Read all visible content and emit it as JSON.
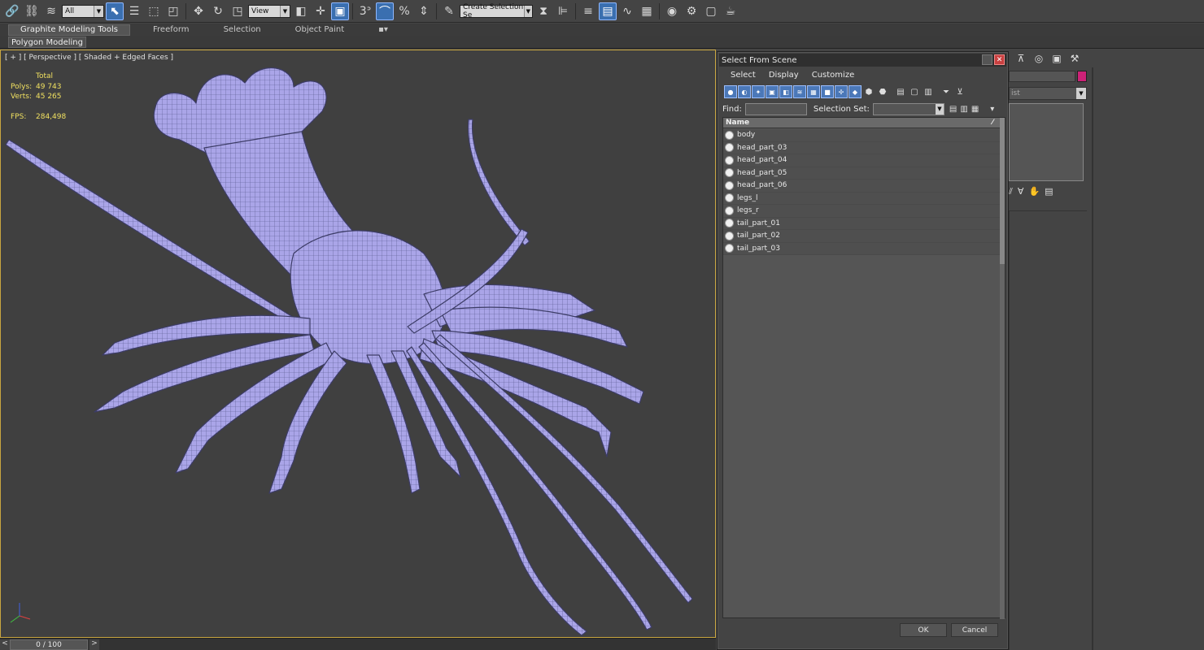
{
  "toolbar": {
    "selection_filter": "All",
    "reference_coord": "View",
    "named_selection_placeholder": "Create Selection Se",
    "snap_angle_label": "3",
    "icons": [
      "link-icon",
      "unlink-icon",
      "bind-icon",
      "select-icon",
      "select-by-name-icon",
      "rect-select-icon",
      "window-crossing-icon",
      "move-icon",
      "rotate-icon",
      "scale-icon",
      "pivot-icon",
      "manipulate-icon",
      "snap-icon",
      "angle-snap-icon",
      "percent-snap-icon",
      "spinner-snap-icon",
      "edit-named-sel-icon",
      "mirror-icon",
      "align-icon",
      "layer-icon",
      "toggle-ribbon-icon",
      "curve-editor-icon",
      "schematic-icon",
      "material-editor-icon",
      "render-setup-icon",
      "render-frame-icon",
      "render-icon"
    ]
  },
  "ribbon": {
    "tabs": [
      {
        "label": "Graphite Modeling Tools",
        "active": true
      },
      {
        "label": "Freeform",
        "active": false
      },
      {
        "label": "Selection",
        "active": false
      },
      {
        "label": "Object Paint",
        "active": false
      }
    ],
    "sub_label": "Polygon Modeling"
  },
  "viewport": {
    "label": "[ + ] [ Perspective ] [ Shaded + Edged Faces ]",
    "stats": {
      "total_label": "Total",
      "polys_label": "Polys:",
      "polys_value": "49 743",
      "verts_label": "Verts:",
      "verts_value": "45 265",
      "fps_label": "FPS:",
      "fps_value": "284,498"
    },
    "model_color": "#a9a4e6",
    "wire_color": "#44446a"
  },
  "timeline": {
    "left": "<",
    "frame": "0 / 100",
    "right": ">"
  },
  "command_panel": {
    "list_combo_text": "ist",
    "color_swatch": "#cc2277"
  },
  "dialog": {
    "title": "Select From Scene",
    "menu": [
      "Select",
      "Display",
      "Customize"
    ],
    "find_label": "Find:",
    "selection_set_label": "Selection Set:",
    "column_name": "Name",
    "items": [
      "body",
      "head_part_03",
      "head_part_04",
      "head_part_05",
      "head_part_06",
      "legs_l",
      "legs_r",
      "tail_part_01",
      "tail_part_02",
      "tail_part_03"
    ],
    "ok_label": "OK",
    "cancel_label": "Cancel"
  }
}
